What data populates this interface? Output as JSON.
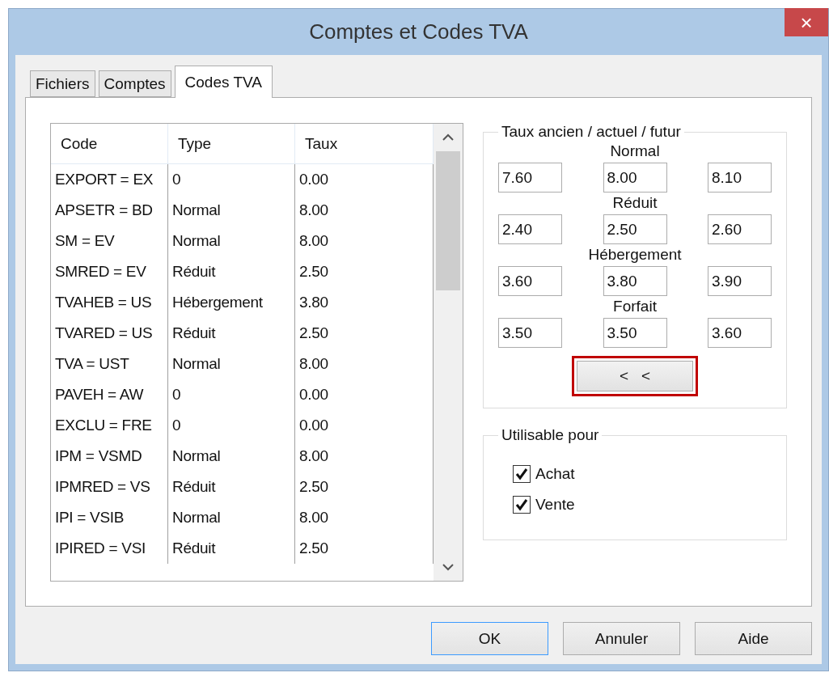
{
  "window": {
    "title": "Comptes et Codes TVA",
    "close": "×"
  },
  "tabs": [
    {
      "label": "Fichiers",
      "selected": false
    },
    {
      "label": "Comptes",
      "selected": false
    },
    {
      "label": "Codes TVA",
      "selected": true
    }
  ],
  "table": {
    "columns": [
      "Code",
      "Type",
      "Taux"
    ],
    "rows": [
      [
        "EXPORT = EX",
        "0",
        "0.00"
      ],
      [
        "APSETR = BD",
        "Normal",
        "8.00"
      ],
      [
        "SM = EV",
        "Normal",
        "8.00"
      ],
      [
        "SMRED = EV",
        "Réduit",
        "2.50"
      ],
      [
        "TVAHEB = US",
        "Hébergement",
        "3.80"
      ],
      [
        "TVARED = US",
        "Réduit",
        "2.50"
      ],
      [
        "TVA = UST",
        "Normal",
        "8.00"
      ],
      [
        "PAVEH = AW",
        "0",
        "0.00"
      ],
      [
        "EXCLU = FRE",
        "0",
        "0.00"
      ],
      [
        "IPM = VSMD",
        "Normal",
        "8.00"
      ],
      [
        "IPMRED = VS",
        "Réduit",
        "2.50"
      ],
      [
        "IPI = VSIB",
        "Normal",
        "8.00"
      ],
      [
        "IPIRED = VSI",
        "Réduit",
        "2.50"
      ]
    ]
  },
  "rates": {
    "title": "Taux ancien / actuel / futur",
    "groups": [
      {
        "label": "Normal",
        "values": [
          "7.60",
          "8.00",
          "8.10"
        ]
      },
      {
        "label": "Réduit",
        "values": [
          "2.40",
          "2.50",
          "2.60"
        ]
      },
      {
        "label": "Hébergement",
        "values": [
          "3.60",
          "3.80",
          "3.90"
        ]
      },
      {
        "label": "Forfait",
        "values": [
          "3.50",
          "3.50",
          "3.60"
        ]
      }
    ],
    "shift_button": {
      "label": "<   <",
      "highlighted": true
    }
  },
  "usable_for": {
    "title": "Utilisable pour",
    "options": [
      {
        "label": "Achat",
        "checked": true
      },
      {
        "label": "Vente",
        "checked": true
      }
    ]
  },
  "buttons": [
    {
      "label": "OK",
      "focused": true
    },
    {
      "label": "Annuler",
      "focused": false
    },
    {
      "label": "Aide",
      "focused": false
    }
  ]
}
